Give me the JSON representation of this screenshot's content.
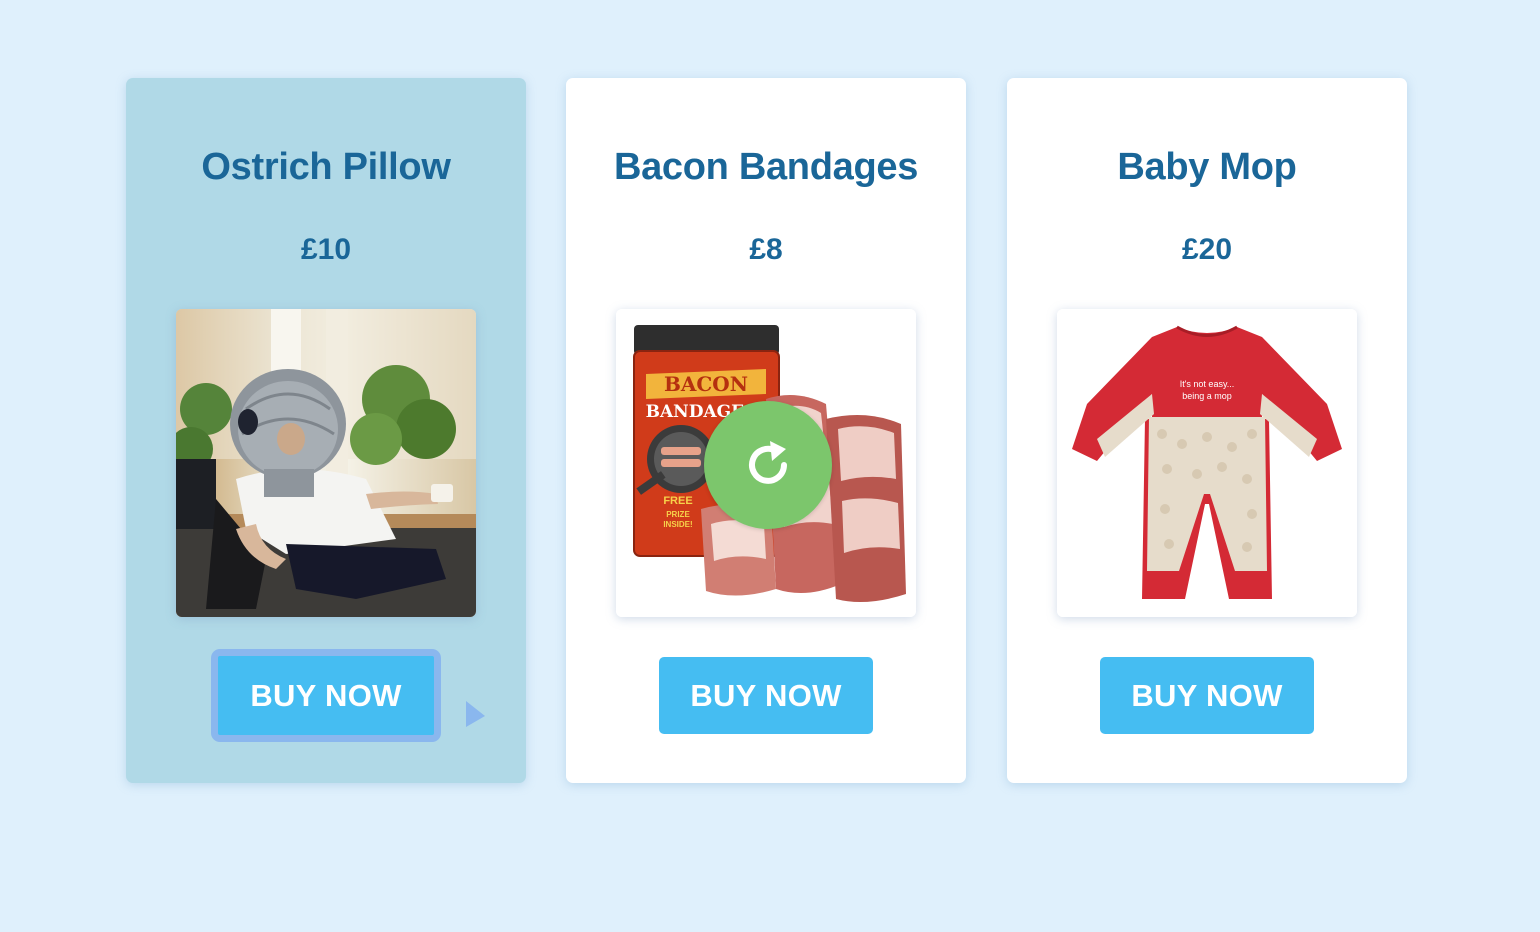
{
  "products": [
    {
      "name": "Ostrich Pillow",
      "price": "£10",
      "image": "ostrich-pillow-photo",
      "button_label": "BUY NOW",
      "selected": true
    },
    {
      "name": "Bacon Bandages",
      "price": "£8",
      "image": "bacon-bandages-photo",
      "button_label": "BUY NOW",
      "loading_icon": "reload-icon",
      "box_text": {
        "brand": "BACON",
        "product": "BANDAGES",
        "promo": "FREE PRIZE INSIDE!"
      }
    },
    {
      "name": "Baby Mop",
      "price": "£20",
      "image": "baby-mop-photo",
      "button_label": "BUY NOW",
      "garment_text": "It's not easy... being a mop"
    }
  ],
  "colors": {
    "page_background": "#dff0fc",
    "card_background": "#ffffff",
    "selected_card_background": "#b0d9e7",
    "heading": "#1a6698",
    "button": "#45bdf2",
    "button_focus_ring": "#8ab7ee",
    "reload_overlay": "#7cc66c",
    "cursor": "#8ab7ee"
  }
}
